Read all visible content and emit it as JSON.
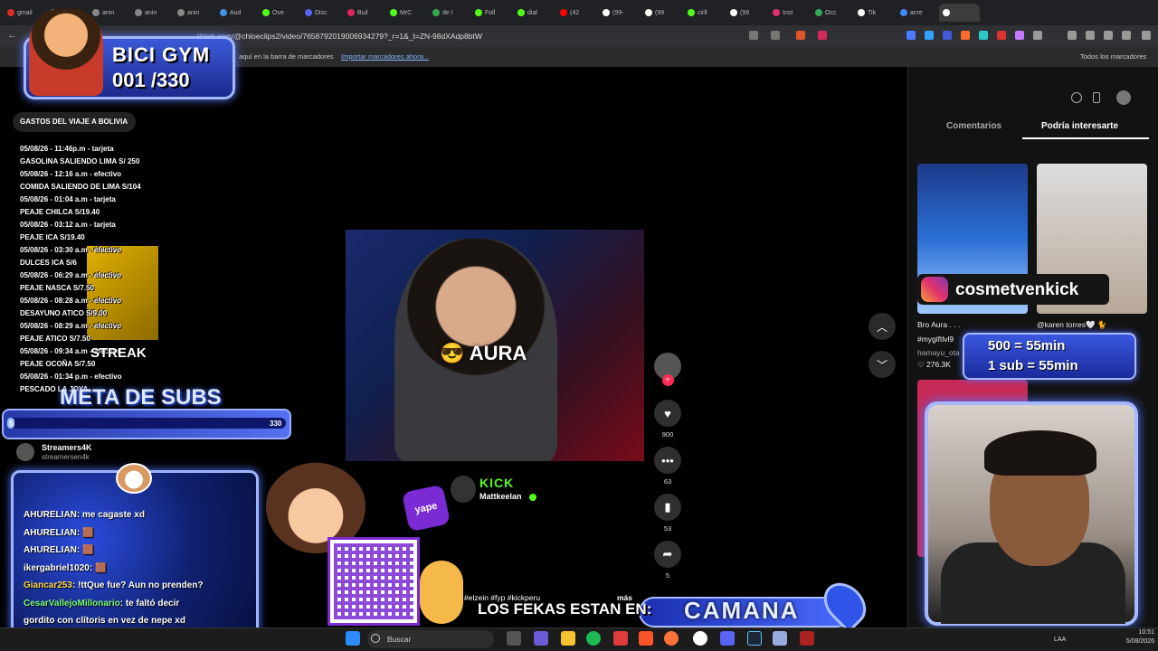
{
  "browser": {
    "tabs": [
      {
        "label": "gmail"
      },
      {
        "label": "anin"
      },
      {
        "label": "anin"
      },
      {
        "label": "anin"
      },
      {
        "label": "anin"
      },
      {
        "label": "Aud"
      },
      {
        "label": "Ove"
      },
      {
        "label": "Disc"
      },
      {
        "label": "Buil"
      },
      {
        "label": "MrC"
      },
      {
        "label": "de I"
      },
      {
        "label": "Foll"
      },
      {
        "label": "dial"
      },
      {
        "label": "(42"
      },
      {
        "label": "(99-"
      },
      {
        "label": "(99"
      },
      {
        "label": "cirll"
      },
      {
        "label": "(99"
      },
      {
        "label": "Inst"
      },
      {
        "label": "Occ"
      },
      {
        "label": "Tik"
      },
      {
        "label": "acre"
      },
      {
        "label": ""
      }
    ],
    "url": "tiktok.com/@chloeclips2/video/7658792019006934279?_r=1&_t=ZN-98dXAdp8btW",
    "bookmark_hint": "aquí en la barra de marcadores",
    "bookmark_import": "Importar marcadores ahora...",
    "all_bookmarks": "Todos los marcadores"
  },
  "overlay": {
    "bici_title": "BICI GYM",
    "bici_count": "001 /330",
    "gastos_title": "GASTOS DEL VIAJE A BOLIVIA",
    "gastos_lines": [
      "05/08/26 - 11:46p.m - tarjeta",
      "GASOLINA SALIENDO LIMA  S/ 250",
      "05/08/26 - 12:16 a.m -  efectivo",
      "COMIDA SALIENDO DE LIMA S/104",
      "05/08/26 - 01:04 a.m -  tarjeta",
      "PEAJE CHILCA  S/19.40",
      "05/08/26 - 03:12 a.m -  tarjeta",
      "PEAJE ICA  S/19.40",
      "05/08/26 - 03:30 a.m -  efectivo",
      "DULCES ICA S/6",
      "05/08/26 - 06:29 a.m -  efectivo",
      "PEAJE NASCA  S/7.50",
      "05/08/26 - 08:28 a.m -  efectivo",
      "DESAYUNO ATICO  S/9.00",
      "05/08/26 - 08:29 a.m -  efectivo",
      "PEAJE ATICO S/7.50",
      "05/08/26 - 09:34 a.m -  efectivo",
      "PEAJE OCOÑA S/7.50",
      "05/08/26 - 01:34 p.m -  efectivo",
      "PESCADO LA JOYA"
    ],
    "streak": "STREAK",
    "meta_title": "META DE SUBS",
    "meta_start": "5",
    "meta_end": "330",
    "meta_progress": 0.015,
    "kick_logo": "KICK",
    "kick_user": "Mattkeelan",
    "yape": "yape",
    "fekas": "LOS FEKAS ESTAN EN:",
    "camana": "CAMANA",
    "instagram_handle": "cosmetvenkick",
    "promo_line1": "500 = 55min",
    "promo_line2": "1 sub = 55min"
  },
  "video": {
    "caption_overlay": "😎 AURA",
    "hashtags": "#elzein #fyp #kickperu",
    "more": "más",
    "likes": "900",
    "comments": "63",
    "saves": "53",
    "shares": "5"
  },
  "sidebar_account": {
    "name": "Streamers4K",
    "handle": "streamersen4k"
  },
  "chat": [
    {
      "user": "AHURELIAN",
      "text": "me cagaste xd",
      "color": "#ffffff"
    },
    {
      "user": "AHURELIAN",
      "text": "🟫",
      "color": "#ffffff"
    },
    {
      "user": "AHURELIAN",
      "text": "🟫",
      "color": "#ffffff"
    },
    {
      "user": "ikergabriel1020",
      "text": "🟫",
      "color": "#ffffff"
    },
    {
      "user": "Giancar253",
      "text": "!ttQue fue? Aun no prenden?",
      "color": "#ffd84a"
    },
    {
      "user": "CesarVallejoMillonario",
      "text": "te faltó decir",
      "color": "#7dff7d"
    },
    {
      "user": "",
      "text": "gordito con clítoris en vez de nepe xd",
      "color": "#ffffff"
    }
  ],
  "right_panel": {
    "tab_comments": "Comentarios",
    "tab_interest": "Podría interesarte",
    "video1_title": "Bro Aura . . .",
    "video1_tag": "#mygiftlvl9",
    "video1_author": "hamayu_ota",
    "video1_likes": "276.3K",
    "video2_title": "@karen torres🤍 🐈"
  },
  "taskbar": {
    "search_placeholder": "Buscar",
    "lang": "LAA",
    "time": "10:51",
    "date": "5/08/2026"
  }
}
